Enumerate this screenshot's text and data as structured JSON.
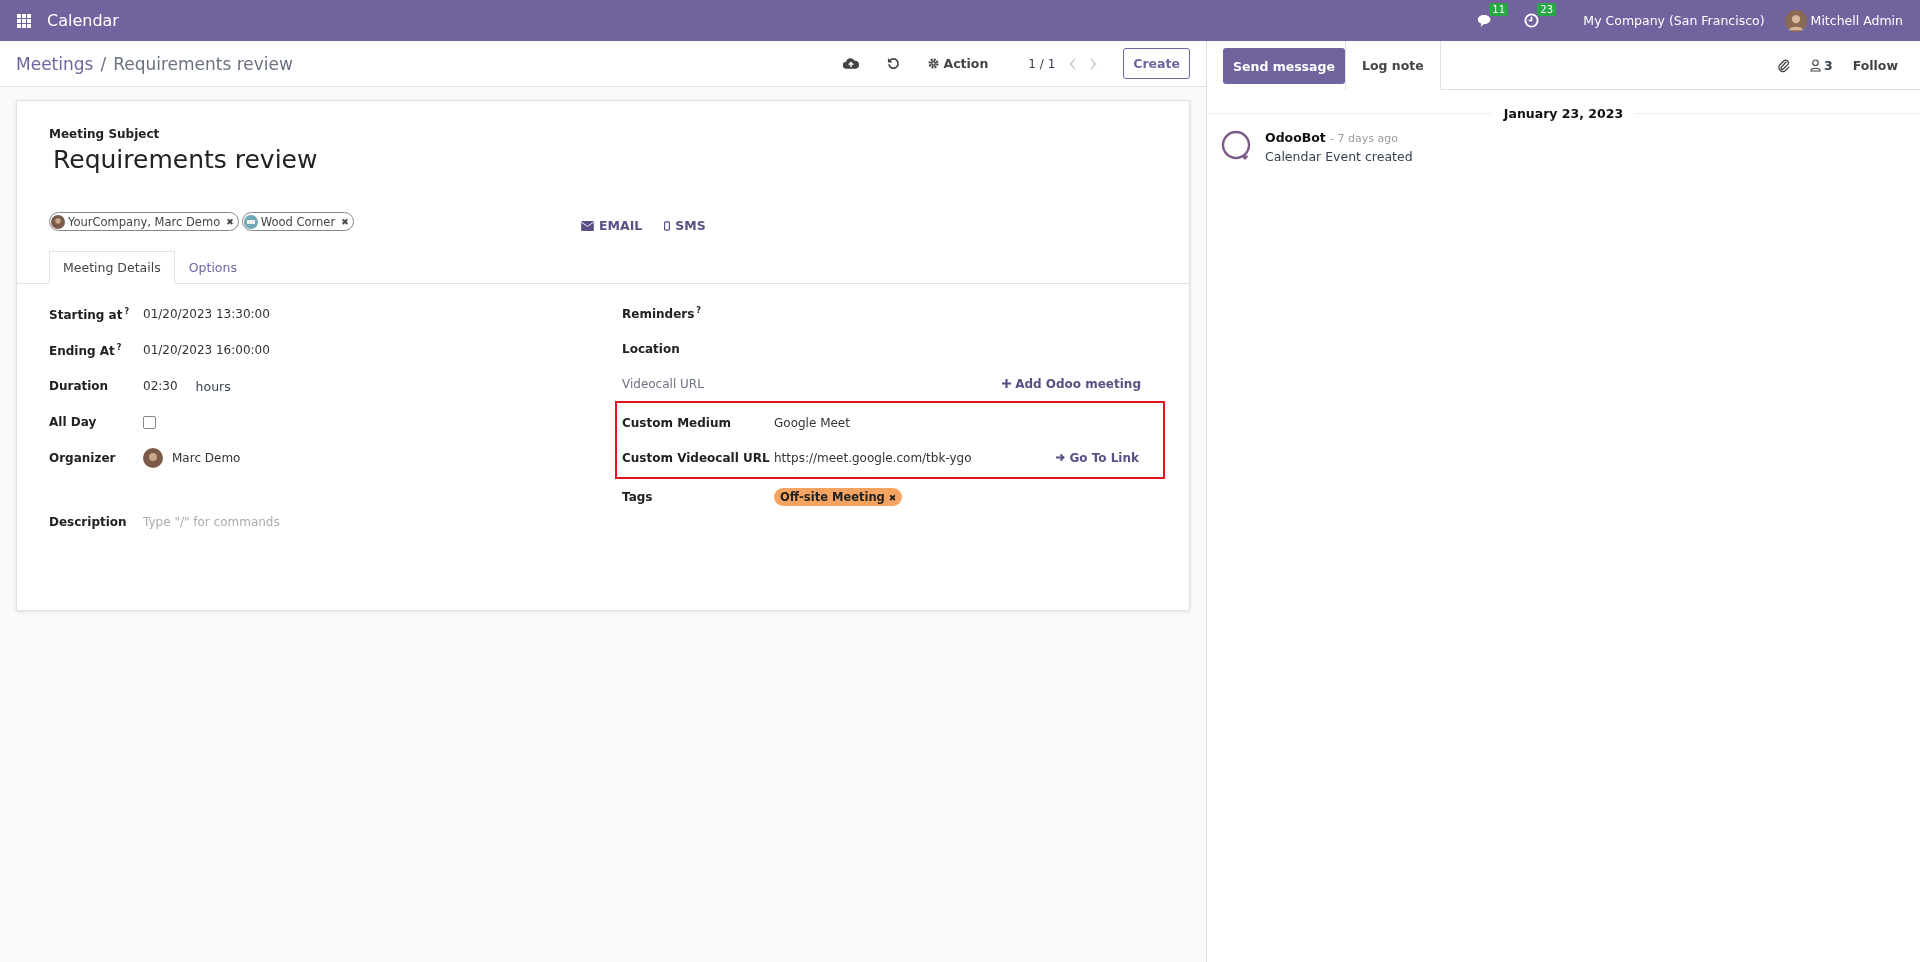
{
  "navbar": {
    "app_name": "Calendar",
    "messages_count": "11",
    "activities_count": "23",
    "company": "My Company (San Francisco)",
    "user": "Mitchell Admin"
  },
  "control_panel": {
    "breadcrumb_parent": "Meetings",
    "separator": "/",
    "breadcrumb_current": "Requirements review",
    "action_label": "Action",
    "pager": "1 / 1",
    "create_label": "Create"
  },
  "form": {
    "subject_label": "Meeting Subject",
    "subject": "Requirements review",
    "attendees": [
      {
        "name": "YourCompany, Marc Demo",
        "kind": "person",
        "remove": "✖"
      },
      {
        "name": "Wood Corner",
        "kind": "company",
        "remove": "✖"
      }
    ],
    "send_buttons": [
      {
        "label": "EMAIL",
        "kind": "email"
      },
      {
        "label": "SMS",
        "kind": "sms"
      }
    ],
    "tabs": [
      {
        "label": "Meeting Details",
        "selected": true
      },
      {
        "label": "Options",
        "selected": false
      }
    ],
    "left_fields": [
      {
        "label": "Starting at",
        "help": "?",
        "kind": "text",
        "value": "01/20/2023 13:30:00"
      },
      {
        "label": "Ending At",
        "help": "?",
        "kind": "text",
        "value": "01/20/2023 16:00:00"
      },
      {
        "label": "Duration",
        "kind": "duration",
        "value": "02:30",
        "unit": "hours"
      },
      {
        "label": "All Day",
        "kind": "checkbox",
        "checked": false
      },
      {
        "label": "Organizer",
        "kind": "avatar",
        "value": "Marc Demo"
      },
      {
        "label": "Description",
        "kind": "placeholder",
        "placeholder": "Type \"/\" for commands"
      }
    ],
    "right_groups": [
      {
        "highlighted": false,
        "fields": [
          {
            "label": "Reminders",
            "help": "?",
            "kind": "empty",
            "muted": false
          },
          {
            "label": "Location",
            "kind": "empty",
            "muted": false
          },
          {
            "label": "Videocall URL",
            "kind": "action",
            "muted": true,
            "action": "Add Odoo meeting"
          }
        ]
      },
      {
        "highlighted": true,
        "fields": [
          {
            "label": "Custom Medium",
            "kind": "text",
            "muted": false,
            "value": "Google Meet"
          },
          {
            "label": "Custom Videocall URL",
            "kind": "link",
            "muted": false,
            "value": "https://meet.google.com/tbk-ygo",
            "action": "Go To Link"
          }
        ]
      },
      {
        "highlighted": false,
        "fields": [
          {
            "label": "Tags",
            "kind": "tag",
            "muted": false,
            "value": "Off-site Meeting",
            "remove": "✖",
            "color": "#f4a460"
          }
        ]
      }
    ]
  },
  "chatter": {
    "send_label": "Send message",
    "log_label": "Log note",
    "followers_count": "3",
    "follow_label": "Follow",
    "date": "January 23, 2023",
    "messages": [
      {
        "author": "OdooBot",
        "time": "- 7 days ago",
        "body": "Calendar Event created"
      }
    ]
  }
}
